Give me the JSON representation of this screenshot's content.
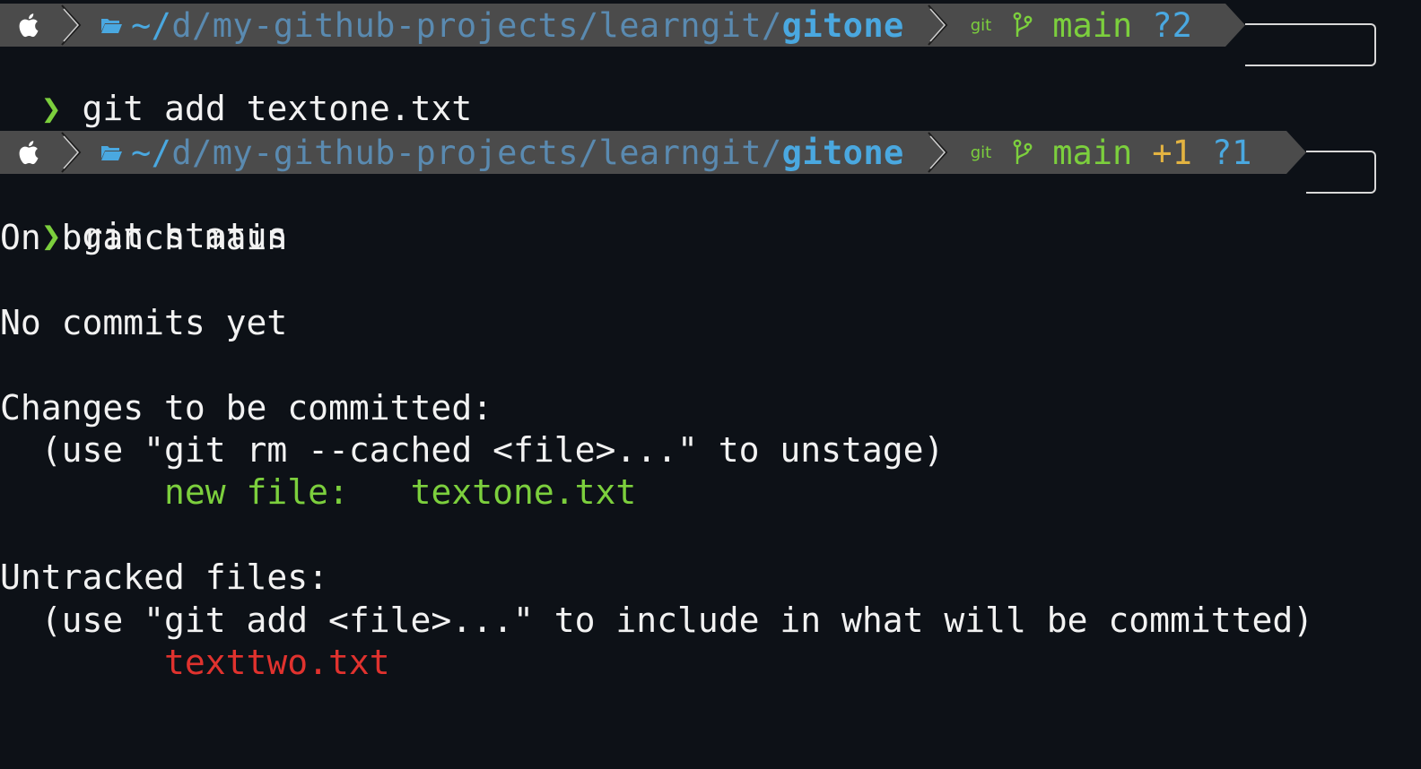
{
  "prompts": [
    {
      "path_tilde": "~/",
      "path_dim": "d/my-github-projects/learngit/",
      "path_bold": "gitone",
      "git_label": "git",
      "branch": "main",
      "staged": "",
      "untracked": "?2",
      "command": "git add textone.txt"
    },
    {
      "path_tilde": "~/",
      "path_dim": "d/my-github-projects/learngit/",
      "path_bold": "gitone",
      "git_label": "git",
      "branch": "main",
      "staged": "+1",
      "untracked": "?1",
      "command": "git status"
    }
  ],
  "prompt_symbol": "❯",
  "output": {
    "branch_line": "On branch main",
    "no_commits": "No commits yet",
    "changes_header": "Changes to be committed:",
    "changes_hint": "  (use \"git rm --cached <file>...\" to unstage)",
    "new_file_label": "        new file:   ",
    "new_file_name": "textone.txt",
    "untracked_header": "Untracked files:",
    "untracked_hint": "  (use \"git add <file>...\" to include in what will be committed)",
    "untracked_file": "        texttwo.txt"
  },
  "colors": {
    "background": "#0d1117",
    "bar": "#4b4b4b",
    "green": "#7ccf3d",
    "blue": "#4aa8e0",
    "yellow": "#e3b341",
    "red": "#e0322e"
  }
}
